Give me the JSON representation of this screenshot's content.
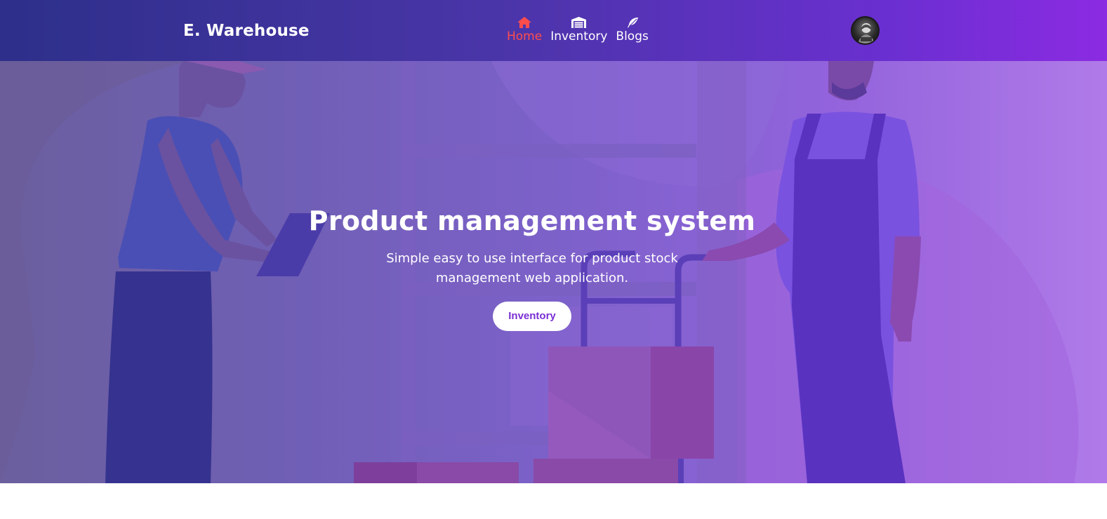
{
  "brand": {
    "name": "E. Warehouse"
  },
  "nav": {
    "items": [
      {
        "label": "Home",
        "icon": "home-icon",
        "active": true
      },
      {
        "label": "Inventory",
        "icon": "warehouse-icon",
        "active": false
      },
      {
        "label": "Blogs",
        "icon": "feather-icon",
        "active": false
      }
    ]
  },
  "hero": {
    "title": "Product management system",
    "subtitle": "Simple easy to use interface for product stock management web application.",
    "button_label": "Inventory"
  },
  "colors": {
    "nav_active": "#ff4d4d",
    "button_text": "#7a2fd6",
    "nav_gradient_start": "#2d2f8a",
    "nav_gradient_end": "#8b2be2"
  }
}
